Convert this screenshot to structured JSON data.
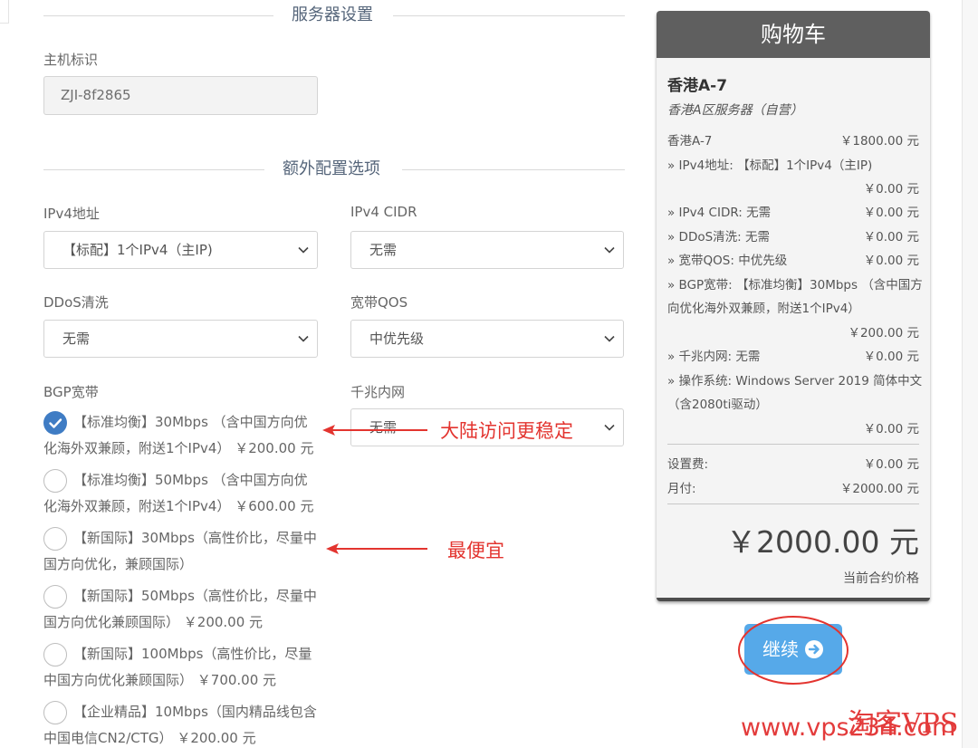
{
  "server_settings": {
    "section_title": "服务器设置",
    "hostname_label": "主机标识",
    "hostname_value": "ZJI-8f2865"
  },
  "extra_config": {
    "section_title": "额外配置选项",
    "ipv4": {
      "label": "IPv4地址",
      "value": "【标配】1个IPv4（主IP)"
    },
    "ipv4_cidr": {
      "label": "IPv4 CIDR",
      "value": "无需"
    },
    "ddos": {
      "label": "DDoS清洗",
      "value": "无需"
    },
    "qos": {
      "label": "宽带QOS",
      "value": "中优先级"
    },
    "gigabit": {
      "label": "千兆内网",
      "value": "无需"
    },
    "bgp": {
      "label": "BGP宽带",
      "options": [
        {
          "line1": "【标准均衡】30Mbps （含中国方向优",
          "line2": "化海外双兼顾，附送1个IPv4） ￥200.00 元",
          "checked": true
        },
        {
          "line1": "【标准均衡】50Mbps （含中国方向优",
          "line2": "化海外双兼顾，附送1个IPv4） ￥600.00 元",
          "checked": false
        },
        {
          "line1": "【新国际】30Mbps（高性价比，尽量中",
          "line2": "国方向优化，兼顾国际）",
          "checked": false
        },
        {
          "line1": "【新国际】50Mbps（高性价比，尽量中",
          "line2": "国方向优化兼顾国际） ￥200.00 元",
          "checked": false
        },
        {
          "line1": "【新国际】100Mbps（高性价比，尽量",
          "line2": "中国方向优化兼顾国际） ￥700.00 元",
          "checked": false
        },
        {
          "line1": "【企业精品】10Mbps（国内精品线包含",
          "line2": "中国电信CN2/CTG） ￥200.00 元",
          "checked": false
        }
      ]
    }
  },
  "annotations": {
    "stable": "大陆访问更稳定",
    "cheapest": "最便宜"
  },
  "cart": {
    "title": "购物车",
    "product_name": "香港A-7",
    "product_group": "香港A区服务器（自营）",
    "base": {
      "label": "香港A-7",
      "price": "￥1800.00 元"
    },
    "ipv4": {
      "label": "» IPv4地址: 【标配】1个IPv4（主IP)",
      "price": "￥0.00 元"
    },
    "cidr": {
      "label": "» IPv4 CIDR: 无需",
      "price": "￥0.00 元"
    },
    "ddos": {
      "label": "» DDoS清洗: 无需",
      "price": "￥0.00 元"
    },
    "qos": {
      "label": "» 宽带QOS: 中优先级",
      "price": "￥0.00 元"
    },
    "bgp": {
      "line1": "» BGP宽带: 【标准均衡】30Mbps （含中国方",
      "line2": "向优化海外双兼顾，附送1个IPv4）",
      "price": "￥200.00 元"
    },
    "lan": {
      "label": "» 千兆内网: 无需",
      "price": "￥0.00 元"
    },
    "os": {
      "line1": "» 操作系统: Windows Server 2019 简体中文",
      "line2": "（含2080ti驱动）",
      "price": "￥0.00 元"
    },
    "setup": {
      "label": "设置费:",
      "price": "￥0.00 元"
    },
    "monthly": {
      "label": "月付:",
      "price": "￥2000.00 元"
    },
    "total": "￥2000.00 元",
    "total_caption": "当前合约价格"
  },
  "continue_button": {
    "label": "继续"
  },
  "watermark": {
    "brand": "淘客VPS",
    "url": "www.vps234.com"
  },
  "colors": {
    "accent": "#3f7cc4",
    "button": "#56a9e9",
    "annotation": "#e3342f",
    "cart_header": "#5f5f5f"
  }
}
